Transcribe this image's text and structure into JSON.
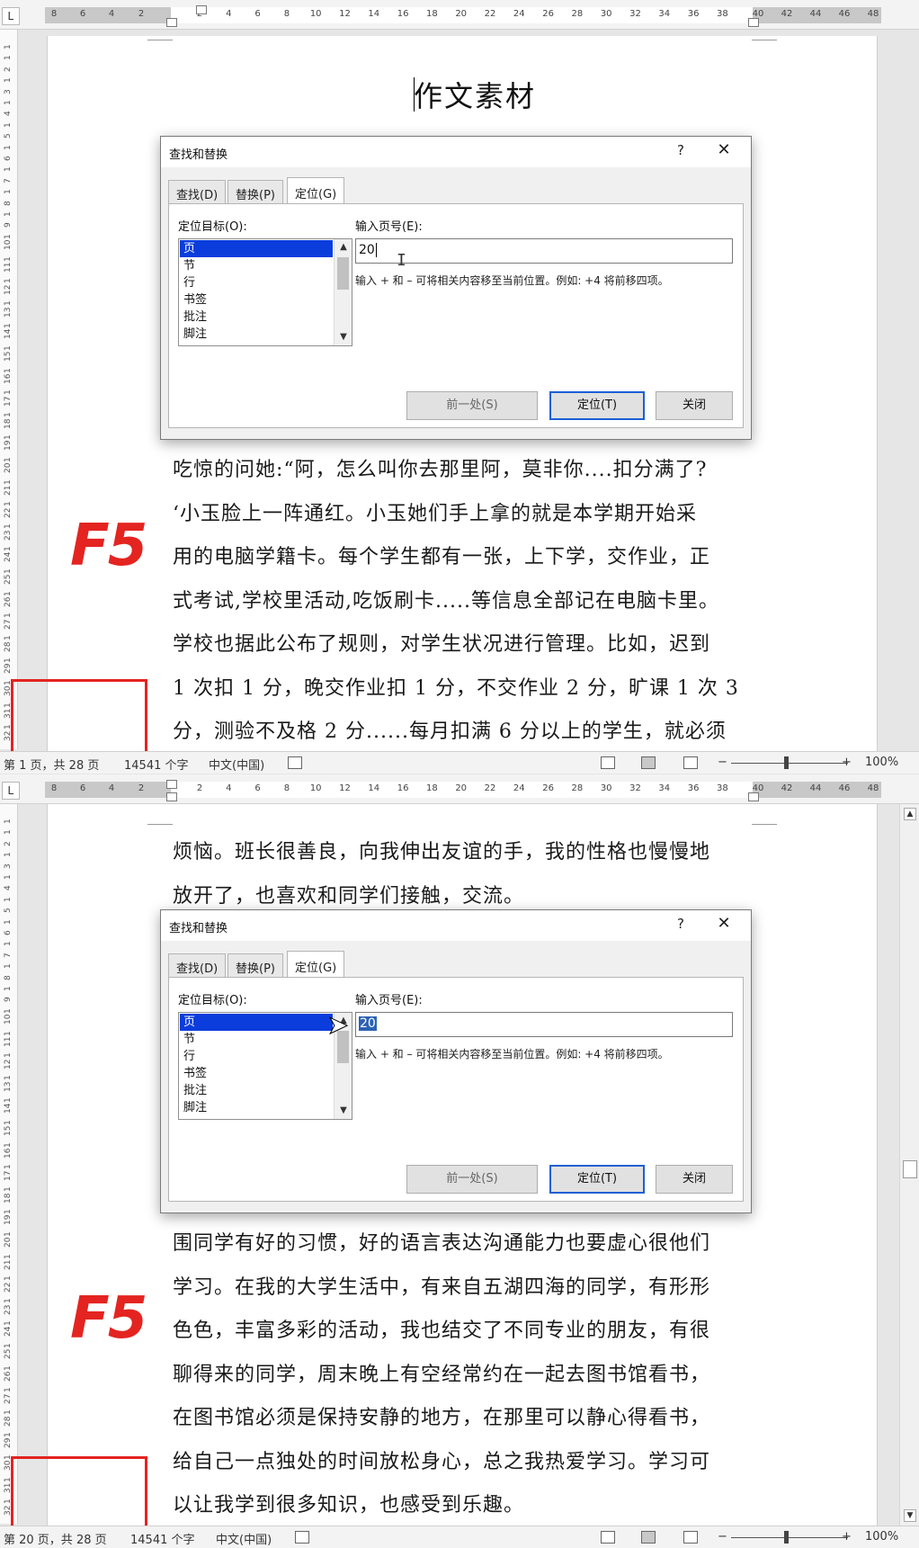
{
  "panel1": {
    "ruler_corner": "L",
    "ruler_numbers": [
      "8",
      "6",
      "4",
      "2",
      "2",
      "4",
      "6",
      "8",
      "10",
      "12",
      "14",
      "16",
      "18",
      "20",
      "22",
      "24",
      "26",
      "28",
      "30",
      "32",
      "34",
      "36",
      "38",
      "40",
      "42",
      "44",
      "46",
      "48"
    ],
    "vruler_numbers": [
      "1",
      "1",
      "2",
      "1",
      "3",
      "1",
      "4",
      "1",
      "5",
      "1",
      "6",
      "1",
      "7",
      "1",
      "8",
      "1",
      "9",
      "1",
      "10",
      "1",
      "11",
      "1",
      "12",
      "1",
      "13",
      "1",
      "14",
      "1",
      "15",
      "1",
      "16",
      "1",
      "17",
      "1",
      "18",
      "1",
      "19",
      "1",
      "20",
      "1",
      "21",
      "1",
      "22",
      "1",
      "23",
      "1",
      "24",
      "1",
      "25",
      "1",
      "26",
      "1",
      "27",
      "1",
      "28",
      "1",
      "29",
      "1",
      "30",
      "1",
      "31",
      "1",
      "32"
    ],
    "doc_title": "作文素材",
    "body_lines": [
      "吃惊的问她:“阿，怎么叫你去那里阿，莫非你....扣分满了?",
      "‘小玉脸上一阵通红。小玉她们手上拿的就是本学期开始采",
      "用的电脑学籍卡。每个学生都有一张，上下学，交作业，正",
      "式考试,学校里活动,吃饭刷卡.....等信息全部记在电脑卡里。",
      "学校也据此公布了规则，对学生状况进行管理。比如，迟到",
      "1 次扣 1 分，晚交作业扣 1 分，不交作业 2 分，旷课 1 次 3",
      "分，测验不及格 2 分......每月扣满 6 分以上的学生，就必须"
    ],
    "f5_label": "F5",
    "dialog": {
      "title": "查找和替换",
      "help": "?",
      "close": "✕",
      "tabs": [
        "查找(D)",
        "替换(P)",
        "定位(G)"
      ],
      "target_label": "定位目标(O):",
      "targets": [
        "页",
        "节",
        "行",
        "书签",
        "批注",
        "脚注"
      ],
      "selected_target": "页",
      "page_label": "输入页号(E):",
      "page_value": "20",
      "hint": "输入 + 和 – 可将相关内容移至当前位置。例如: +4 将前移四项。",
      "btn_prev": "前一处(S)",
      "btn_goto": "定位(T)",
      "btn_close": "关闭"
    },
    "status": {
      "page": "第 1 页，共 28 页",
      "words": "14541 个字",
      "lang": "中文(中国)",
      "zoom": "100%"
    }
  },
  "panel2": {
    "ruler_corner": "L",
    "ruler_numbers": [
      "8",
      "6",
      "4",
      "2",
      "2",
      "4",
      "6",
      "8",
      "10",
      "12",
      "14",
      "16",
      "18",
      "20",
      "22",
      "24",
      "26",
      "28",
      "30",
      "32",
      "34",
      "36",
      "38",
      "40",
      "42",
      "44",
      "46",
      "48"
    ],
    "vruler_numbers": [
      "1",
      "1",
      "2",
      "1",
      "3",
      "1",
      "4",
      "1",
      "5",
      "1",
      "6",
      "1",
      "7",
      "1",
      "8",
      "1",
      "9",
      "1",
      "10",
      "1",
      "11",
      "1",
      "12",
      "1",
      "13",
      "1",
      "14",
      "1",
      "15",
      "1",
      "16",
      "1",
      "17",
      "1",
      "18",
      "1",
      "19",
      "1",
      "20",
      "1",
      "21",
      "1",
      "22",
      "1",
      "23",
      "1",
      "24",
      "1",
      "25",
      "1",
      "26",
      "1",
      "27",
      "1",
      "28",
      "1",
      "29",
      "1",
      "30",
      "1",
      "31",
      "1",
      "32"
    ],
    "top_lines": [
      "烦恼。班长很善良，向我伸出友谊的手，我的性格也慢慢地",
      "放开了，也喜欢和同学们接触，交流。"
    ],
    "body_lines": [
      "围同学有好的习惯，好的语言表达沟通能力也要虚心很他们",
      "学习。在我的大学生活中，有来自五湖四海的同学，有形形",
      "色色，丰富多彩的活动，我也结交了不同专业的朋友，有很",
      "聊得来的同学，周末晚上有空经常约在一起去图书馆看书，",
      "在图书馆必须是保持安静的地方，在那里可以静心得看书，",
      "给自己一点独处的时间放松身心，总之我热爱学习。学习可",
      "以让我学到很多知识，也感受到乐趣。"
    ],
    "f5_label": "F5",
    "dialog": {
      "title": "查找和替换",
      "help": "?",
      "close": "✕",
      "tabs": [
        "查找(D)",
        "替换(P)",
        "定位(G)"
      ],
      "target_label": "定位目标(O):",
      "targets": [
        "页",
        "节",
        "行",
        "书签",
        "批注",
        "脚注"
      ],
      "selected_target": "页",
      "page_label": "输入页号(E):",
      "page_value": "20",
      "hint": "输入 + 和 – 可将相关内容移至当前位置。例如: +4 将前移四项。",
      "btn_prev": "前一处(S)",
      "btn_goto": "定位(T)",
      "btn_close": "关闭"
    },
    "status": {
      "page": "第 20 页，共 28 页",
      "words": "14541 个字",
      "lang": "中文(中国)",
      "zoom": "100%"
    }
  },
  "colors": {
    "accent_red": "#e42420",
    "selection_blue": "#0a3ddc",
    "default_button_border": "#1b60d5"
  }
}
